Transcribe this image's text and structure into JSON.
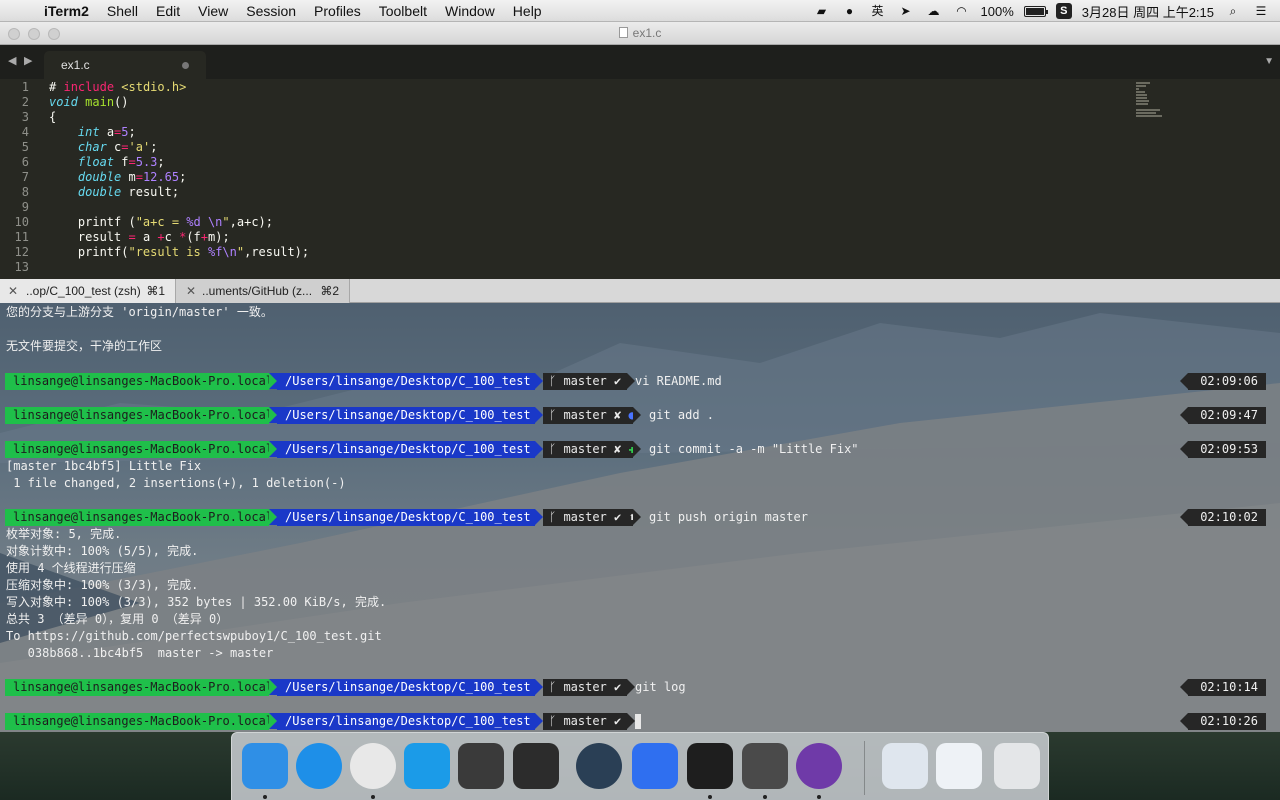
{
  "menubar": {
    "apple": "",
    "app_name": "iTerm2",
    "items": [
      "Shell",
      "Edit",
      "View",
      "Session",
      "Profiles",
      "Toolbelt",
      "Window",
      "Help"
    ],
    "ime_label": "英",
    "battery_percent": "100%",
    "battery_level": 1.0,
    "clock": "3月28日 周四 上午2:15"
  },
  "window": {
    "title": "ex1.c"
  },
  "editor": {
    "tab_label": "ex1.c",
    "lines": [
      {
        "n": "1"
      },
      {
        "n": "2"
      },
      {
        "n": "3"
      },
      {
        "n": "4"
      },
      {
        "n": "5"
      },
      {
        "n": "6"
      },
      {
        "n": "7"
      },
      {
        "n": "8"
      },
      {
        "n": "9"
      },
      {
        "n": "10"
      },
      {
        "n": "11"
      },
      {
        "n": "12"
      },
      {
        "n": "13"
      }
    ],
    "code": {
      "l1_hash": "#",
      "l1_include": "include",
      "l1_header": "<stdio.h>",
      "l2_type": "void",
      "l2_fn": "main",
      "l2_rest": "()",
      "l3": "{",
      "l4_type": "int",
      "l4_var": " a",
      "l4_eq": "=",
      "l4_num": "5",
      "l4_end": ";",
      "l5_type": "char",
      "l5_var": " c",
      "l5_eq": "=",
      "l5_str": "'a'",
      "l5_end": ";",
      "l6_type": "float",
      "l6_var": " f",
      "l6_eq": "=",
      "l6_num": "5.3",
      "l6_end": ";",
      "l7_type": "double",
      "l7_var": " m",
      "l7_eq": "=",
      "l7_num": "12.65",
      "l7_end": ";",
      "l8_type": "double",
      "l8_rest": " result;",
      "l9": "",
      "l10_a": "printf (",
      "l10_str1": "\"a+c = ",
      "l10_fmt": "%d",
      "l10_esc": " \\n",
      "l10_str2": "\"",
      "l10_b": ",a+c);",
      "l11_a": "result ",
      "l11_eq": "=",
      "l11_b": " a ",
      "l11_op1": "+",
      "l11_c": "c ",
      "l11_op2": "*",
      "l11_d": "(f",
      "l11_op3": "+",
      "l11_e": "m);",
      "l12_a": "printf(",
      "l12_str1": "\"result is ",
      "l12_fmt": "%f",
      "l12_esc": "\\n",
      "l12_str2": "\"",
      "l12_b": ",result);",
      "l13": ""
    }
  },
  "terminal_tabs": [
    {
      "close": "✕",
      "title": "..op/C_100_test (zsh)",
      "shortcut": "⌘1"
    },
    {
      "close": "✕",
      "title": "..uments/GitHub (z...",
      "shortcut": "⌘2"
    }
  ],
  "terminal": {
    "out_top1": "您的分支与上游分支 'origin/master' 一致。",
    "out_top2": "无文件要提交，干净的工作区",
    "user": "linsange@linsanges-MacBook-Pro.local",
    "path": "/Users/linsange/Desktop/C_100_test",
    "branch_icon": "ᚴ",
    "branch": "master",
    "prompts": [
      {
        "git_mark": "✔",
        "extra_mark": "",
        "cmd": "vi README.md",
        "time": "02:09:06"
      },
      {
        "git_mark": "✘",
        "extra_mark": "●",
        "cmd": "git add .",
        "time": "02:09:47"
      },
      {
        "git_mark": "✘",
        "extra_mark": "✚",
        "cmd": "git commit -a -m \"Little Fix\"",
        "time": "02:09:53"
      },
      {
        "git_mark": "✔",
        "extra_mark": "⬆",
        "cmd": "git push origin master",
        "time": "02:10:02"
      },
      {
        "git_mark": "✔",
        "extra_mark": "",
        "cmd": "git log",
        "time": "02:10:14"
      },
      {
        "git_mark": "✔",
        "extra_mark": "",
        "cmd": "",
        "time": "02:10:26"
      }
    ],
    "commit_out1": "[master 1bc4bf5] Little Fix",
    "commit_out2": " 1 file changed, 2 insertions(+), 1 deletion(-)",
    "push_out": [
      "枚举对象: 5, 完成.",
      "对象计数中: 100% (5/5), 完成.",
      "使用 4 个线程进行压缩",
      "压缩对象中: 100% (3/3), 完成.",
      "写入对象中: 100% (3/3), 352 bytes | 352.00 KiB/s, 完成.",
      "总共 3 （差异 0），复用 0 （差异 0）",
      "To https://github.com/perfectswpuboy1/C_100_test.git",
      "   038b868..1bc4bf5  master -> master"
    ]
  },
  "dock": {
    "apps": [
      {
        "name": "finder-icon",
        "color": "#2f8fe6",
        "running": true
      },
      {
        "name": "safari-icon",
        "color": "#1e8fe8",
        "running": false
      },
      {
        "name": "chrome-icon",
        "color": "#e8e8e8",
        "running": true
      },
      {
        "name": "app-5-icon",
        "color": "#1b9be8",
        "running": false
      },
      {
        "name": "evernote-icon",
        "color": "#3a3a3a",
        "running": false
      },
      {
        "name": "gmail-app-icon",
        "color": "#2c2c2c",
        "running": false
      },
      {
        "name": "quicktime-icon",
        "color": "#2a3f55",
        "running": false
      },
      {
        "name": "wps-icon",
        "color": "#2f6ff0",
        "running": false
      },
      {
        "name": "terminal-icon",
        "color": "#1e1e1e",
        "running": true
      },
      {
        "name": "sublime-text-icon",
        "color": "#4a4a4a",
        "running": true
      },
      {
        "name": "github-desktop-icon",
        "color": "#6f3aa8",
        "running": true
      },
      {
        "name": "preview-docs-icon",
        "color": "#dfe6ee",
        "running": false
      },
      {
        "name": "screenshot-github-icon",
        "color": "#eef2f6",
        "running": false
      },
      {
        "name": "trash-icon",
        "color": "#e4e6e8",
        "running": false
      }
    ]
  }
}
